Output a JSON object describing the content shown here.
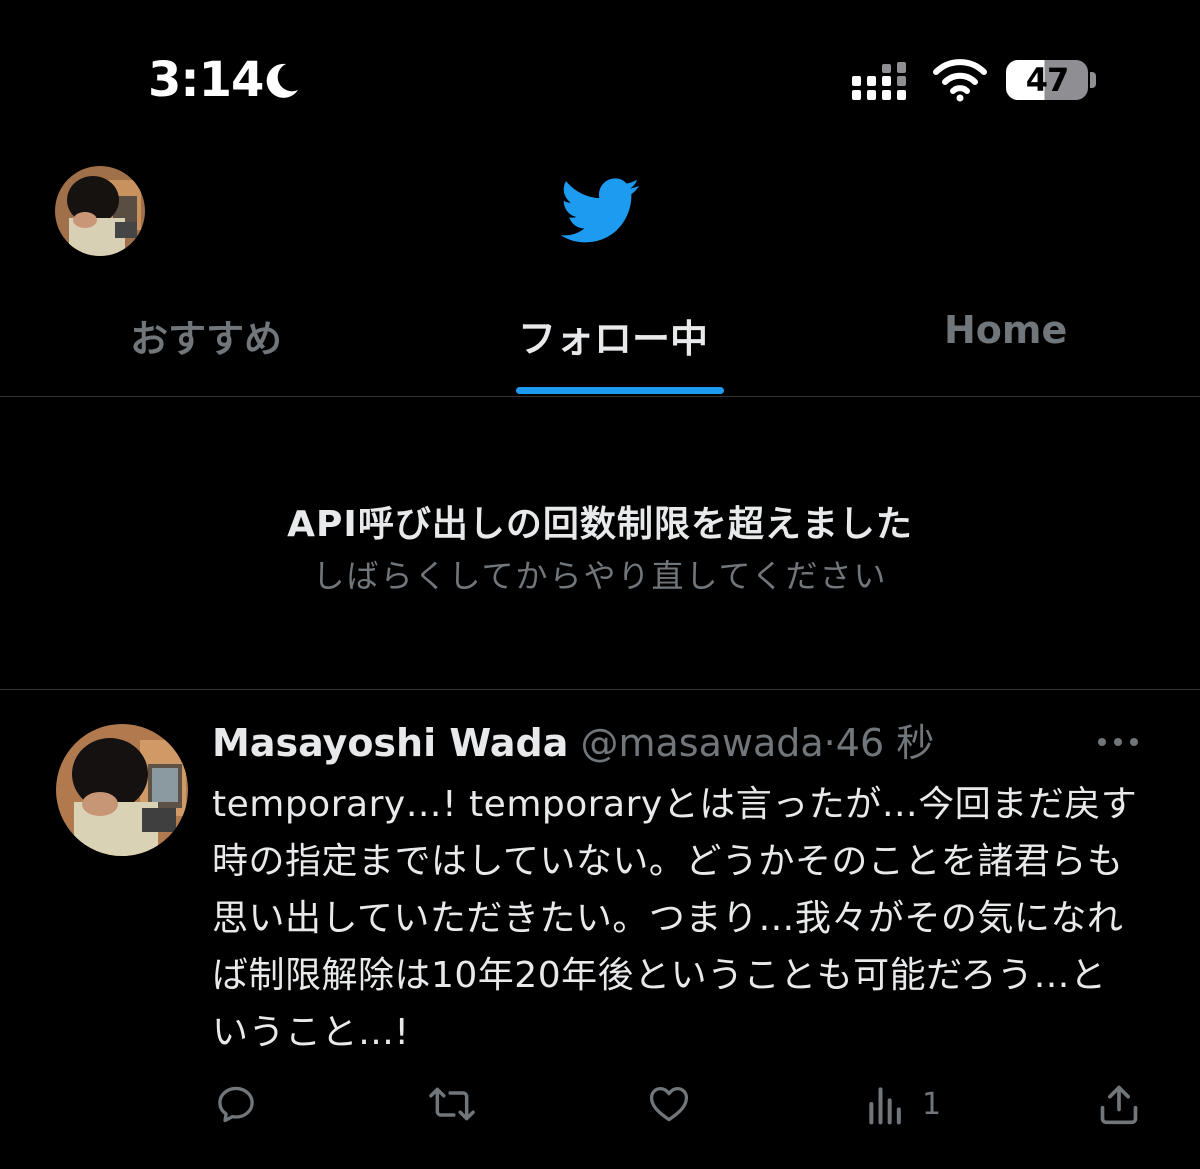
{
  "status_bar": {
    "time": "3:14",
    "battery_level": "47",
    "icons": [
      "moon-icon",
      "signal-icon",
      "wifi-icon",
      "battery-icon"
    ]
  },
  "header": {
    "logo": "twitter-bird-icon",
    "accent_color": "#1d9bf0"
  },
  "tabs": [
    {
      "label": "おすすめ",
      "active": false
    },
    {
      "label": "フォロー中",
      "active": true
    },
    {
      "label": "Home",
      "active": false
    }
  ],
  "notice": {
    "title": "API呼び出しの回数制限を超えました",
    "subtitle": "しばらくしてからやり直してください"
  },
  "tweet": {
    "display_name": "Masayoshi Wada",
    "handle": "@masawada",
    "separator": "·",
    "time": "46 秒",
    "text": "temporary…! temporaryとは言ったが…今回まだ戻す時の指定まではしていない。どうかそのことを諸君らも思い出していただきたい。つまり…我々がその気になれば制限解除は10年20年後ということも可能だろう…ということ…!",
    "actions": {
      "reply": "reply-icon",
      "retweet": "retweet-icon",
      "like": "heart-icon",
      "views": "views-icon",
      "views_count": "1",
      "share": "share-icon"
    }
  }
}
